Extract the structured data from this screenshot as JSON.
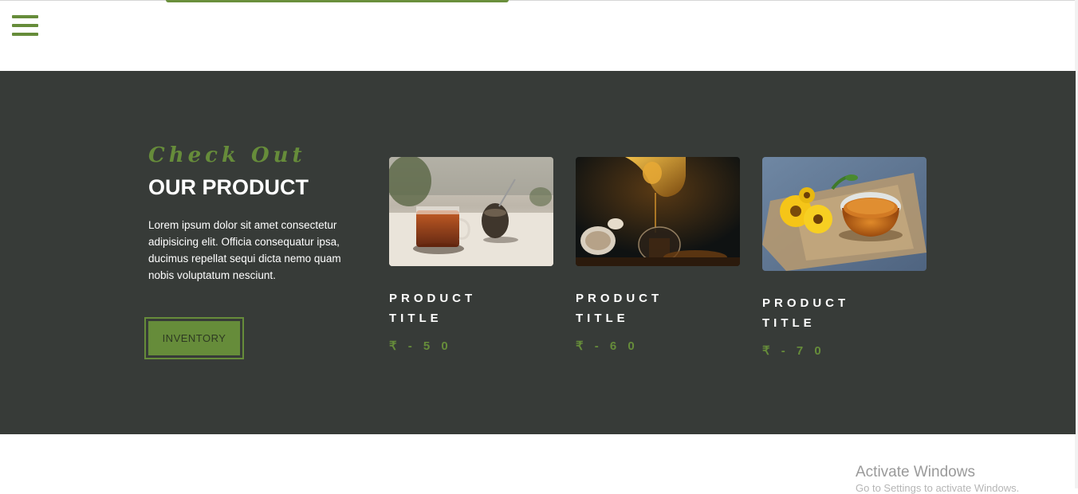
{
  "nav": {
    "menu_icon": "hamburger-menu-icon"
  },
  "intro": {
    "eyebrow": "Check Out",
    "title": "OUR PRODUCT",
    "description": "Lorem ipsum dolor sit amet consectetur adipisicing elit. Officia consequatur ipsa, ducimus repellat sequi dicta nemo quam nobis voluptatum nesciunt.",
    "button_label": "INVENTORY"
  },
  "products": [
    {
      "title": "PRODUCT TITLE",
      "price": "₹ - 5 0",
      "image": "tea-glass-window-photo"
    },
    {
      "title": "PRODUCT TITLE",
      "price": "₹ - 6 0",
      "image": "tea-pouring-kettle-photo"
    },
    {
      "title": "PRODUCT TITLE",
      "price": "₹ - 7 0",
      "image": "tea-cup-flowers-photo"
    }
  ],
  "system": {
    "watermark": "Activate Windows",
    "watermark_sub": "Go to Settings to activate Windows."
  },
  "colors": {
    "accent": "#668c3a",
    "section_bg": "#373b38",
    "text_light": "#ffffff"
  }
}
